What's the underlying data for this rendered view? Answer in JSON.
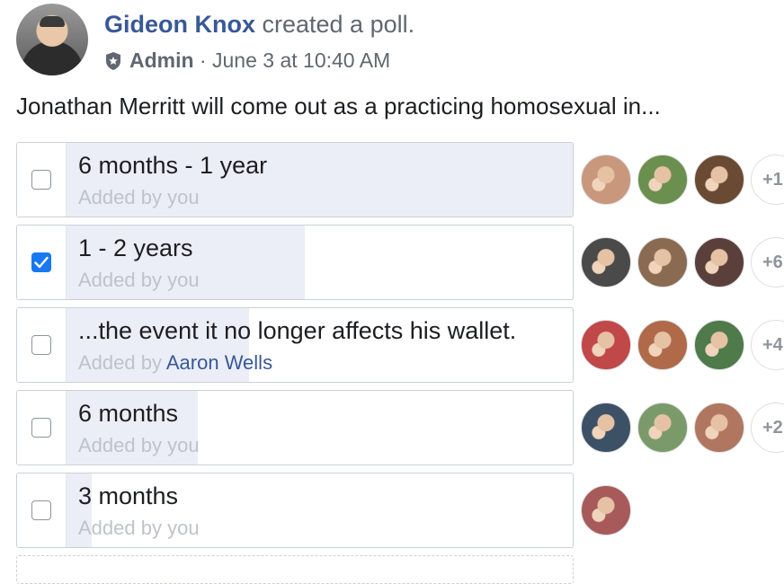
{
  "post": {
    "author": "Gideon Knox",
    "action": " created a poll.",
    "role": "Admin",
    "separator": " · ",
    "timestamp": "June 3 at 10:40 AM",
    "question": "Jonathan Merritt will come out as a practicing homosexual in..."
  },
  "poll": {
    "options": [
      {
        "label": "6 months - 1 year",
        "added_prefix": "Added by ",
        "added_by": "you",
        "added_by_is_link": false,
        "checked": false,
        "vote_share": 1.0,
        "more": "+1",
        "voter_colors": [
          "#c9977c",
          "#6b8f4e",
          "#6b4a34"
        ]
      },
      {
        "label": "1 - 2 years",
        "added_prefix": "Added by ",
        "added_by": "you",
        "added_by_is_link": false,
        "checked": true,
        "vote_share": 0.47,
        "more": "+6",
        "voter_colors": [
          "#4a4a4a",
          "#8a6a50",
          "#5a3f3a"
        ]
      },
      {
        "label": "...the event it no longer affects his wallet.",
        "added_prefix": "Added by ",
        "added_by": "Aaron Wells",
        "added_by_is_link": true,
        "checked": false,
        "vote_share": 0.36,
        "more": "+4",
        "voter_colors": [
          "#c04848",
          "#b06a4a",
          "#4f7a4a"
        ]
      },
      {
        "label": "6 months",
        "added_prefix": "Added by ",
        "added_by": "you",
        "added_by_is_link": false,
        "checked": false,
        "vote_share": 0.26,
        "more": "+2",
        "voter_colors": [
          "#3d5166",
          "#7a9a6a",
          "#b07660"
        ]
      },
      {
        "label": "3 months",
        "added_prefix": "Added by ",
        "added_by": "you",
        "added_by_is_link": false,
        "checked": false,
        "vote_share": 0.05,
        "more": "",
        "voter_colors": [
          "#a85a5a"
        ]
      }
    ]
  },
  "icons": {
    "role_badge": "shield-star-icon",
    "check": "checkmark-icon"
  },
  "colors": {
    "link": "#385898",
    "bar": "#ebeef6",
    "checkbox_checked": "#1877f2"
  }
}
